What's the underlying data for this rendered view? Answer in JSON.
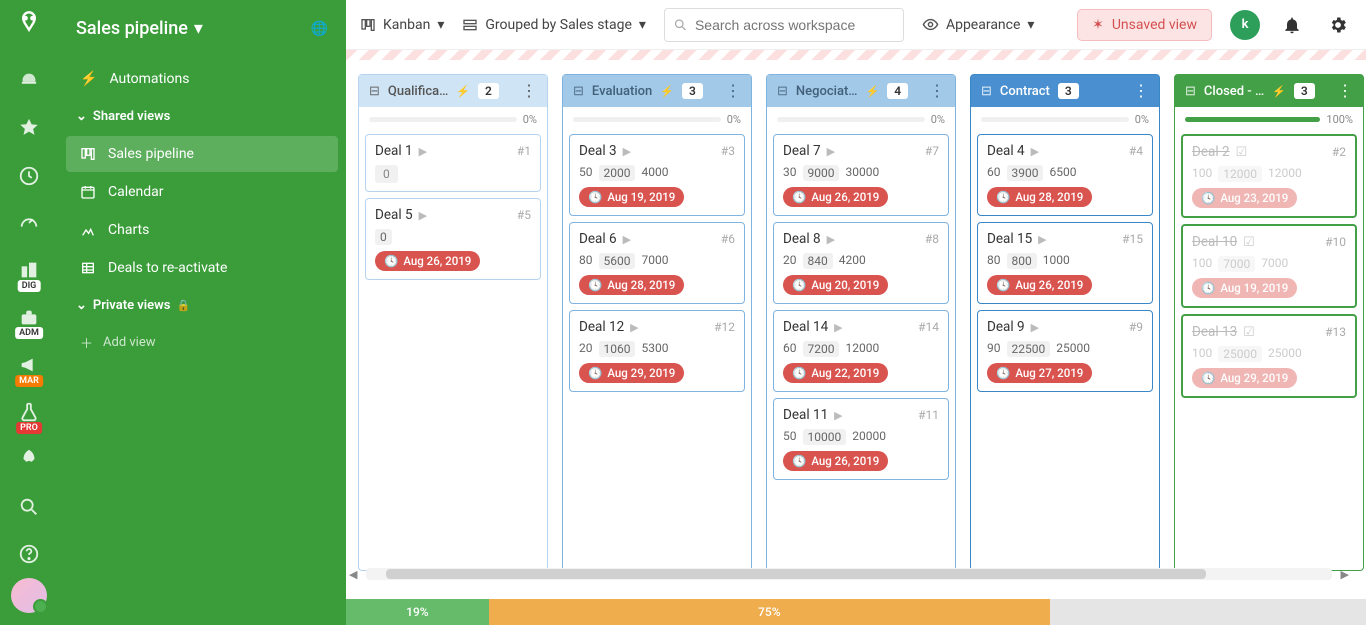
{
  "appTitle": "Sales pipeline",
  "sidebar": {
    "automations": "Automations",
    "sharedLabel": "Shared views",
    "privateLabel": "Private views",
    "addView": "Add view",
    "items": [
      {
        "label": "Sales pipeline",
        "active": true
      },
      {
        "label": "Calendar"
      },
      {
        "label": "Charts"
      },
      {
        "label": "Deals to re-activate"
      }
    ]
  },
  "toolbar": {
    "viewType": "Kanban",
    "groupBy": "Grouped by Sales stage",
    "searchPlaceholder": "Search across workspace",
    "appearance": "Appearance",
    "unsaved": "Unsaved view",
    "avatarLetter": "k"
  },
  "columns": [
    {
      "title": "Qualifica…",
      "count": 2,
      "progress": "0%",
      "progressPct": 0,
      "style": "lightblue",
      "bolt": true,
      "cards": [
        {
          "name": "Deal 1",
          "id": "#1",
          "nums": [
            {
              "v": "0",
              "boxed": true,
              "only": true
            }
          ]
        },
        {
          "name": "Deal 5",
          "id": "#5",
          "nums": [
            {
              "v": "0",
              "boxed": true
            }
          ],
          "due": "Aug 26, 2019"
        }
      ]
    },
    {
      "title": "Evaluation",
      "count": 3,
      "progress": "0%",
      "progressPct": 0,
      "style": "medblue",
      "bolt": true,
      "cards": [
        {
          "name": "Deal 3",
          "id": "#3",
          "nums": [
            {
              "v": "50"
            },
            {
              "v": "2000",
              "boxed": true
            },
            {
              "v": "4000"
            }
          ],
          "due": "Aug 19, 2019"
        },
        {
          "name": "Deal 6",
          "id": "#6",
          "nums": [
            {
              "v": "80"
            },
            {
              "v": "5600",
              "boxed": true
            },
            {
              "v": "7000"
            }
          ],
          "due": "Aug 28, 2019"
        },
        {
          "name": "Deal 12",
          "id": "#12",
          "nums": [
            {
              "v": "20"
            },
            {
              "v": "1060",
              "boxed": true
            },
            {
              "v": "5300"
            }
          ],
          "due": "Aug 29, 2019"
        }
      ]
    },
    {
      "title": "Negociat…",
      "count": 4,
      "progress": "0%",
      "progressPct": 0,
      "style": "medblue",
      "bolt": true,
      "cards": [
        {
          "name": "Deal 7",
          "id": "#7",
          "nums": [
            {
              "v": "30"
            },
            {
              "v": "9000",
              "boxed": true
            },
            {
              "v": "30000"
            }
          ],
          "due": "Aug 26, 2019"
        },
        {
          "name": "Deal 8",
          "id": "#8",
          "nums": [
            {
              "v": "20"
            },
            {
              "v": "840",
              "boxed": true
            },
            {
              "v": "4200"
            }
          ],
          "due": "Aug 20, 2019"
        },
        {
          "name": "Deal 14",
          "id": "#14",
          "nums": [
            {
              "v": "60"
            },
            {
              "v": "7200",
              "boxed": true
            },
            {
              "v": "12000"
            }
          ],
          "due": "Aug 22, 2019"
        },
        {
          "name": "Deal 11",
          "id": "#11",
          "nums": [
            {
              "v": "50"
            },
            {
              "v": "10000",
              "boxed": true
            },
            {
              "v": "20000"
            }
          ],
          "due": "Aug 26, 2019"
        }
      ]
    },
    {
      "title": "Contract",
      "count": 3,
      "progress": "0%",
      "progressPct": 0,
      "style": "blue",
      "bolt": false,
      "cards": [
        {
          "name": "Deal 4",
          "id": "#4",
          "nums": [
            {
              "v": "60"
            },
            {
              "v": "3900",
              "boxed": true
            },
            {
              "v": "6500"
            }
          ],
          "due": "Aug 28, 2019"
        },
        {
          "name": "Deal 15",
          "id": "#15",
          "nums": [
            {
              "v": "80"
            },
            {
              "v": "800",
              "boxed": true
            },
            {
              "v": "1000"
            }
          ],
          "due": "Aug 26, 2019"
        },
        {
          "name": "Deal 9",
          "id": "#9",
          "nums": [
            {
              "v": "90"
            },
            {
              "v": "22500",
              "boxed": true
            },
            {
              "v": "25000"
            }
          ],
          "due": "Aug 27, 2019"
        }
      ]
    },
    {
      "title": "Closed - …",
      "count": 3,
      "progress": "100%",
      "progressPct": 100,
      "style": "green",
      "bolt": true,
      "cards": [
        {
          "name": "Deal 2",
          "id": "#2",
          "done": true,
          "nums": [
            {
              "v": "100"
            },
            {
              "v": "12000",
              "boxed": true
            },
            {
              "v": "12000"
            }
          ],
          "due": "Aug 23, 2019"
        },
        {
          "name": "Deal 10",
          "id": "#10",
          "done": true,
          "nums": [
            {
              "v": "100"
            },
            {
              "v": "7000",
              "boxed": true
            },
            {
              "v": "7000"
            }
          ],
          "due": "Aug 19, 2019"
        },
        {
          "name": "Deal 13",
          "id": "#13",
          "done": true,
          "nums": [
            {
              "v": "100"
            },
            {
              "v": "25000",
              "boxed": true
            },
            {
              "v": "25000"
            }
          ],
          "due": "Aug 29, 2019"
        }
      ]
    },
    {
      "title": "",
      "count": null,
      "style": "red",
      "trunc": true,
      "cards": []
    }
  ],
  "footer": {
    "green": "19%",
    "orange": "75%"
  }
}
